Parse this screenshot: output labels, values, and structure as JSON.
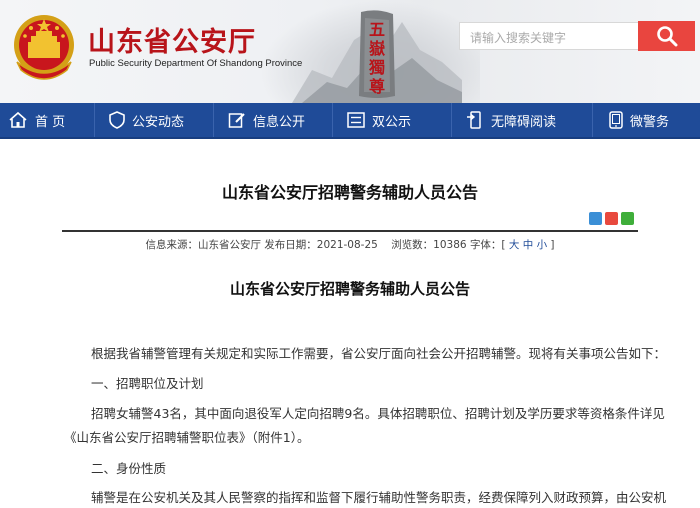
{
  "header": {
    "site_title": "山东省公安厅",
    "site_subtitle": "Public Security Department Of Shandong Province",
    "search_placeholder": "请输入搜索关键字",
    "rock_text": "五嶽獨尊"
  },
  "nav": {
    "items": [
      {
        "label": "首 页",
        "icon": "home-icon"
      },
      {
        "label": "公安动态",
        "icon": "shield-icon"
      },
      {
        "label": "信息公开",
        "icon": "edit-icon"
      },
      {
        "label": "双公示",
        "icon": "list-icon"
      },
      {
        "label": "无障碍阅读",
        "icon": "accessibility-icon"
      },
      {
        "label": "微警务",
        "icon": "mobile-icon"
      }
    ]
  },
  "article": {
    "title": "山东省公安厅招聘警务辅助人员公告",
    "meta": {
      "source": "信息来源：山东省公安厅",
      "date": "发布日期：2021-08-25",
      "views": "浏览数：10386",
      "font_label": "字体：[",
      "font_large": "大",
      "font_medium": "中",
      "font_small": "小",
      "font_close": "]"
    },
    "sub_title": "山东省公安厅招聘警务辅助人员公告",
    "paragraphs": [
      "根据我省辅警管理有关规定和实际工作需要，省公安厅面向社会公开招聘辅警。现将有关事项公告如下：",
      "一、招聘职位及计划",
      "招聘女辅警43名，其中面向退役军人定向招聘9名。具体招聘职位、招聘计划及学历要求等资格条件详见",
      "《山东省公安厅招聘辅警职位表》（附件1）。",
      "二、身份性质",
      "辅警是在公安机关及其人民警察的指挥和监督下履行辅助性警务职责，经费保障列入财政预算，由公安机"
    ]
  },
  "colors": {
    "nav_bg": "#1f4b98",
    "title_red": "#b8141a",
    "search_button": "#e9453f"
  }
}
